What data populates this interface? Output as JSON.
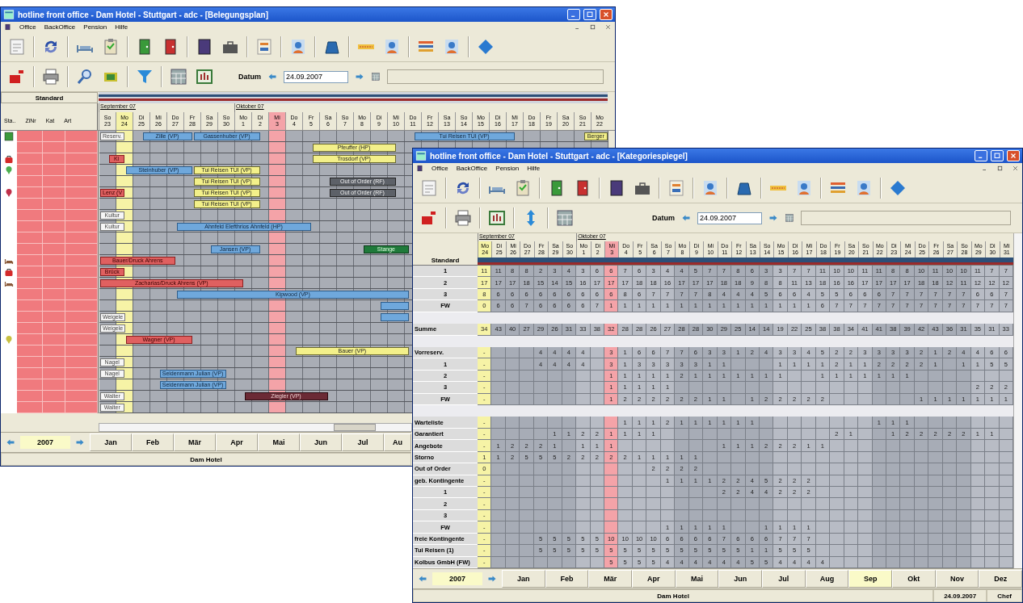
{
  "windows": [
    {
      "kind": "belegungsplan",
      "title": "hotline front office - Dam Hotel - Stuttgart - adc - [Belegungsplan]",
      "menu": [
        "Office",
        "BackOffice",
        "Pension",
        "Hilfe"
      ],
      "date_label": "Datum",
      "date": "24.09.2007",
      "view_button": "Standard",
      "columns": [
        "Sta..",
        "ZiNr",
        "Kat",
        "Art"
      ],
      "days": [
        {
          "dow": "So",
          "day": "23",
          "today": false,
          "holiday": false,
          "month": "September 07"
        },
        {
          "dow": "Mo",
          "day": "24",
          "today": true,
          "holiday": false
        },
        {
          "dow": "Di",
          "day": "25",
          "today": false,
          "holiday": false
        },
        {
          "dow": "Mi",
          "day": "26",
          "today": false,
          "holiday": false
        },
        {
          "dow": "Do",
          "day": "27",
          "today": false,
          "holiday": false
        },
        {
          "dow": "Fr",
          "day": "28",
          "today": false,
          "holiday": false
        },
        {
          "dow": "Sa",
          "day": "29",
          "today": false,
          "holiday": false
        },
        {
          "dow": "So",
          "day": "30",
          "today": false,
          "holiday": false
        },
        {
          "dow": "Mo",
          "day": "1",
          "today": false,
          "holiday": false,
          "month": "Oktober 07"
        },
        {
          "dow": "Di",
          "day": "2",
          "today": false,
          "holiday": false
        },
        {
          "dow": "Mi",
          "day": "3",
          "today": false,
          "holiday": true
        },
        {
          "dow": "Do",
          "day": "4",
          "today": false,
          "holiday": false
        },
        {
          "dow": "Fr",
          "day": "5",
          "today": false,
          "holiday": false
        },
        {
          "dow": "Sa",
          "day": "6",
          "today": false,
          "holiday": false
        },
        {
          "dow": "So",
          "day": "7",
          "today": false,
          "holiday": false
        },
        {
          "dow": "Mo",
          "day": "8",
          "today": false,
          "holiday": false
        },
        {
          "dow": "Di",
          "day": "9",
          "today": false,
          "holiday": false
        },
        {
          "dow": "Mi",
          "day": "10",
          "today": false,
          "holiday": false
        },
        {
          "dow": "Do",
          "day": "11",
          "today": false,
          "holiday": false
        },
        {
          "dow": "Fr",
          "day": "12",
          "today": false,
          "holiday": false
        },
        {
          "dow": "Sa",
          "day": "13",
          "today": false,
          "holiday": false
        },
        {
          "dow": "So",
          "day": "14",
          "today": false,
          "holiday": false
        },
        {
          "dow": "Mo",
          "day": "15",
          "today": false,
          "holiday": false
        },
        {
          "dow": "Di",
          "day": "16",
          "today": false,
          "holiday": false
        },
        {
          "dow": "Mi",
          "day": "17",
          "today": false,
          "holiday": false
        },
        {
          "dow": "Do",
          "day": "18",
          "today": false,
          "holiday": false
        },
        {
          "dow": "Fr",
          "day": "19",
          "today": false,
          "holiday": false
        },
        {
          "dow": "Sa",
          "day": "20",
          "today": false,
          "holiday": false
        },
        {
          "dow": "So",
          "day": "21",
          "today": false,
          "holiday": false
        },
        {
          "dow": "Mo",
          "day": "22",
          "today": false,
          "holiday": false
        }
      ],
      "rooms": [
        {
          "marker": {
            "kind": "square",
            "color": "#3c9a3c"
          },
          "bookings": [
            {
              "label": "Reserv.",
              "kind": "white"
            },
            {
              "label": "Zille (VP)",
              "kind": "blue"
            },
            {
              "label": "Gassenhuber (VP)",
              "kind": "blue"
            },
            {
              "label": "Tui Reisen TUI (VP)",
              "kind": "blue"
            },
            {
              "label": "Berger",
              "kind": "yellow"
            }
          ]
        },
        {
          "bookings": [
            {
              "label": "Pfeuffer (HP)",
              "kind": "yellow"
            }
          ]
        },
        {
          "marker": {
            "kind": "bag",
            "color": "#d42a2a"
          },
          "bookings": [
            {
              "label": "Ki",
              "kind": "red"
            },
            {
              "label": "Trosdorf (VP)",
              "kind": "yellow"
            }
          ]
        },
        {
          "marker": {
            "kind": "pin",
            "color": "#4caf50"
          },
          "bookings": [
            {
              "label": "Steinhuber (VP)",
              "kind": "blue"
            },
            {
              "label": "Tui Reisen TUI (VP)",
              "kind": "yellow"
            }
          ]
        },
        {
          "bookings": [
            {
              "label": "Tui Reisen TUI (VP)",
              "kind": "yellow"
            },
            {
              "label": "Out of Order (RF)",
              "kind": "gray"
            }
          ]
        },
        {
          "marker": {
            "kind": "pin",
            "color": "#c0304a"
          },
          "bookings": [
            {
              "label": "Lenz (V",
              "kind": "red"
            },
            {
              "label": "Tui Reisen TUI (VP)",
              "kind": "yellow"
            },
            {
              "label": "Out of Order (RF)",
              "kind": "gray"
            }
          ]
        },
        {
          "bookings": [
            {
              "label": "Tui Reisen TUI (VP)",
              "kind": "yellow"
            }
          ]
        },
        {
          "bookings": [
            {
              "label": "Kultur",
              "kind": "white"
            }
          ]
        },
        {
          "bookings": [
            {
              "label": "Kultur",
              "kind": "white"
            },
            {
              "label": "Ahnfeld Elefthrios Ahnfeld (HP)",
              "kind": "blue"
            }
          ]
        },
        {
          "selected": false
        },
        {
          "bookings": [
            {
              "label": "Jansen (VP)",
              "kind": "blue"
            },
            {
              "label": "Stange",
              "kind": "green"
            }
          ]
        },
        {
          "marker": {
            "kind": "bed",
            "color": "#8a5a3a"
          },
          "bookings": [
            {
              "label": "Bauer/Druck Ahrens",
              "kind": "red"
            }
          ]
        },
        {
          "marker": {
            "kind": "bag",
            "color": "#d42a2a"
          },
          "bookings": [
            {
              "label": "Brück",
              "kind": "red"
            }
          ]
        },
        {
          "marker": {
            "kind": "bed",
            "color": "#8a5a3a"
          },
          "bookings": [
            {
              "label": "Zacharias/Druck Ahrens (VP)",
              "kind": "red"
            }
          ]
        },
        {
          "bookings": [
            {
              "label": "Kipwood (VP)",
              "kind": "blue"
            }
          ]
        },
        {
          "bookings": [
            {
              "kind": "blue"
            }
          ]
        },
        {
          "bookings": [
            {
              "label": "Weigele",
              "kind": "white"
            },
            {
              "kind": "blue"
            }
          ]
        },
        {
          "bookings": [
            {
              "label": "Weigele",
              "kind": "white"
            }
          ]
        },
        {
          "marker": {
            "kind": "pin",
            "color": "#c8c040"
          },
          "bookings": [
            {
              "label": "Wagner (VP)",
              "kind": "red"
            }
          ]
        },
        {
          "bookings": [
            {
              "label": "Bauer (VP)",
              "kind": "yellow"
            }
          ]
        },
        {
          "bookings": [
            {
              "label": "Nagel",
              "kind": "white"
            }
          ]
        },
        {
          "bookings": [
            {
              "label": "Nagel",
              "kind": "white"
            },
            {
              "label": "Seidenmann Julian (VP)",
              "kind": "blue"
            }
          ]
        },
        {
          "bookings": [
            {
              "label": "Seidenmann Julian (VP)",
              "kind": "blue"
            }
          ]
        },
        {
          "bookings": [
            {
              "label": "Walter",
              "kind": "white"
            },
            {
              "label": "Ziegler (VP)",
              "kind": "maroon"
            }
          ]
        },
        {
          "bookings": [
            {
              "label": "Walter",
              "kind": "white"
            }
          ]
        }
      ],
      "year": "2007",
      "month_tabs": [
        {
          "label": "Jan",
          "selected": false
        },
        {
          "label": "Feb",
          "selected": false
        },
        {
          "label": "Mär",
          "selected": false
        },
        {
          "label": "Apr",
          "selected": false
        },
        {
          "label": "Mai",
          "selected": false
        },
        {
          "label": "Jun",
          "selected": false
        },
        {
          "label": "Jul",
          "selected": false
        },
        {
          "label": "Au",
          "selected": false
        }
      ],
      "status": [
        "Dam Hotel"
      ]
    },
    {
      "kind": "kategoriespiegel",
      "title": "hotline front office - Dam Hotel - Stuttgart - adc - [Kategoriespiegel]",
      "menu": [
        "Office",
        "BackOffice",
        "Pension",
        "Hilfe"
      ],
      "date_label": "Datum",
      "date": "24.09.2007",
      "view_button": "Standard",
      "days": [
        {
          "dow": "Mo",
          "day": "24",
          "today": true,
          "holiday": false,
          "month": "September 07"
        },
        {
          "dow": "Di",
          "day": "25",
          "today": false,
          "holiday": false
        },
        {
          "dow": "Mi",
          "day": "26",
          "today": false,
          "holiday": false
        },
        {
          "dow": "Do",
          "day": "27",
          "today": false,
          "holiday": false
        },
        {
          "dow": "Fr",
          "day": "28",
          "today": false,
          "holiday": false
        },
        {
          "dow": "Sa",
          "day": "29",
          "today": false,
          "holiday": false
        },
        {
          "dow": "So",
          "day": "30",
          "today": false,
          "holiday": false
        },
        {
          "dow": "Mo",
          "day": "1",
          "today": false,
          "holiday": false,
          "month": "Oktober 07"
        },
        {
          "dow": "Di",
          "day": "2",
          "today": false,
          "holiday": false
        },
        {
          "dow": "Mi",
          "day": "3",
          "today": false,
          "holiday": true
        },
        {
          "dow": "Do",
          "day": "4",
          "today": false,
          "holiday": false
        },
        {
          "dow": "Fr",
          "day": "5",
          "today": false,
          "holiday": false
        },
        {
          "dow": "Sa",
          "day": "6",
          "today": false,
          "holiday": false
        },
        {
          "dow": "So",
          "day": "7",
          "today": false,
          "holiday": false
        },
        {
          "dow": "Mo",
          "day": "8",
          "today": false,
          "holiday": false
        },
        {
          "dow": "Di",
          "day": "9",
          "today": false,
          "holiday": false
        },
        {
          "dow": "Mi",
          "day": "10",
          "today": false,
          "holiday": false
        },
        {
          "dow": "Do",
          "day": "11",
          "today": false,
          "holiday": false
        },
        {
          "dow": "Fr",
          "day": "12",
          "today": false,
          "holiday": false
        },
        {
          "dow": "Sa",
          "day": "13",
          "today": false,
          "holiday": false
        },
        {
          "dow": "So",
          "day": "14",
          "today": false,
          "holiday": false
        },
        {
          "dow": "Mo",
          "day": "15",
          "today": false,
          "holiday": false
        },
        {
          "dow": "Di",
          "day": "16",
          "today": false,
          "holiday": false
        },
        {
          "dow": "Mi",
          "day": "17",
          "today": false,
          "holiday": false
        },
        {
          "dow": "Do",
          "day": "18",
          "today": false,
          "holiday": false
        },
        {
          "dow": "Fr",
          "day": "19",
          "today": false,
          "holiday": false
        },
        {
          "dow": "Sa",
          "day": "20",
          "today": false,
          "holiday": false
        },
        {
          "dow": "So",
          "day": "21",
          "today": false,
          "holiday": false
        },
        {
          "dow": "Mo",
          "day": "22",
          "today": false,
          "holiday": false
        },
        {
          "dow": "Di",
          "day": "23",
          "today": false,
          "holiday": false
        },
        {
          "dow": "Mi",
          "day": "24",
          "today": false,
          "holiday": false
        },
        {
          "dow": "Do",
          "day": "25",
          "today": false,
          "holiday": false
        },
        {
          "dow": "Fr",
          "day": "26",
          "today": false,
          "holiday": false
        },
        {
          "dow": "Sa",
          "day": "27",
          "today": false,
          "holiday": false
        },
        {
          "dow": "So",
          "day": "28",
          "today": false,
          "holiday": false
        },
        {
          "dow": "Mo",
          "day": "29",
          "today": false,
          "holiday": false
        },
        {
          "dow": "Di",
          "day": "30",
          "today": false,
          "holiday": false
        },
        {
          "dow": "Mi",
          "day": "31",
          "today": false,
          "holiday": false
        }
      ],
      "rows": [
        {
          "kind": "sub",
          "label": "1",
          "cells": [
            "11",
            "11",
            "8",
            "8",
            "2",
            "3",
            "4",
            "3",
            "6",
            "6",
            "7",
            "6",
            "3",
            "4",
            "4",
            "5",
            "7",
            "7",
            "8",
            "6",
            "3",
            "3",
            "7",
            "7",
            "11",
            "10",
            "10",
            "11",
            "11",
            "8",
            "8",
            "10",
            "11",
            "10",
            "10",
            "11",
            "7",
            "7"
          ]
        },
        {
          "kind": "sub",
          "label": "2",
          "cells": [
            "17",
            "17",
            "17",
            "18",
            "15",
            "14",
            "15",
            "16",
            "17",
            "17",
            "17",
            "18",
            "18",
            "16",
            "17",
            "17",
            "17",
            "18",
            "18",
            "9",
            "8",
            "8",
            "11",
            "13",
            "18",
            "16",
            "16",
            "17",
            "17",
            "17",
            "17",
            "18",
            "18",
            "12",
            "11",
            "12",
            "12",
            "12"
          ]
        },
        {
          "kind": "sub",
          "label": "3",
          "cells": [
            "8",
            "6",
            "6",
            "6",
            "6",
            "6",
            "6",
            "6",
            "6",
            "6",
            "8",
            "6",
            "7",
            "7",
            "7",
            "7",
            "8",
            "4",
            "4",
            "4",
            "5",
            "6",
            "6",
            "4",
            "5",
            "5",
            "6",
            "6",
            "6",
            "7",
            "7",
            "7",
            "7",
            "7",
            "7",
            "6",
            "6",
            "7"
          ]
        },
        {
          "kind": "sub",
          "label": "FW",
          "cells": [
            "0",
            "6",
            "6",
            "7",
            "6",
            "6",
            "6",
            "6",
            "7",
            "1",
            "1",
            "1",
            "1",
            "1",
            "1",
            "1",
            "1",
            "1",
            "1",
            "1",
            "1",
            "1",
            "1",
            "1",
            "6",
            "7",
            "7",
            "7",
            "7",
            "7",
            "7",
            "7",
            "7",
            "7",
            "7",
            "7",
            "7",
            "7"
          ]
        },
        {
          "kind": "spacer"
        },
        {
          "kind": "group",
          "label": "Summe",
          "cells": [
            "34",
            "43",
            "40",
            "27",
            "29",
            "26",
            "31",
            "33",
            "38",
            "32",
            "28",
            "28",
            "26",
            "27",
            "28",
            "28",
            "30",
            "29",
            "25",
            "14",
            "14",
            "19",
            "22",
            "25",
            "38",
            "38",
            "34",
            "41",
            "41",
            "38",
            "39",
            "42",
            "43",
            "36",
            "31",
            "35",
            "31",
            "33"
          ]
        },
        {
          "kind": "spacer"
        },
        {
          "kind": "group",
          "label": "Vorreserv.",
          "cells": [
            "-",
            null,
            null,
            null,
            "4",
            "4",
            "4",
            "4",
            null,
            "3",
            "1",
            "6",
            "6",
            "7",
            "7",
            "6",
            "3",
            "3",
            "1",
            "2",
            "4",
            "3",
            "3",
            "4",
            "5",
            "2",
            "2",
            "3",
            "3",
            "3",
            "3",
            "2",
            "1",
            "2",
            "4",
            "4",
            "6",
            "6"
          ]
        },
        {
          "kind": "sub",
          "label": "1",
          "cells": [
            "-",
            null,
            null,
            null,
            "4",
            "4",
            "4",
            "4",
            null,
            "3",
            "1",
            "3",
            "3",
            "3",
            "3",
            "3",
            "1",
            "1",
            null,
            null,
            null,
            "1",
            "1",
            "1",
            "1",
            "2",
            "1",
            "1",
            "2",
            "2",
            "2",
            "2",
            "1",
            null,
            "1",
            "1",
            "5",
            "5"
          ]
        },
        {
          "kind": "sub",
          "label": "2",
          "cells": [
            "-",
            null,
            null,
            null,
            null,
            null,
            null,
            null,
            null,
            "1",
            "1",
            "1",
            "1",
            "1",
            "2",
            "1",
            "1",
            "1",
            "1",
            "1",
            "1",
            "1",
            null,
            null,
            "1",
            "1",
            "1",
            "1",
            "1",
            "1",
            "1",
            null,
            null,
            null,
            null,
            null,
            null,
            null
          ]
        },
        {
          "kind": "sub",
          "label": "3",
          "cells": [
            "-",
            null,
            null,
            null,
            null,
            null,
            null,
            null,
            null,
            "1",
            "1",
            "1",
            "1",
            "1",
            null,
            null,
            null,
            null,
            null,
            null,
            null,
            null,
            null,
            null,
            null,
            null,
            null,
            null,
            null,
            null,
            null,
            null,
            null,
            null,
            null,
            "2",
            "2",
            "2"
          ]
        },
        {
          "kind": "sub",
          "label": "FW",
          "cells": [
            "-",
            null,
            null,
            null,
            null,
            null,
            null,
            null,
            null,
            "1",
            "2",
            "2",
            "2",
            "2",
            "2",
            "2",
            "1",
            "1",
            null,
            "1",
            "2",
            "2",
            "2",
            "2",
            "2",
            null,
            null,
            null,
            null,
            null,
            null,
            "1",
            "1",
            "1",
            "1",
            "1",
            "1",
            "1"
          ]
        },
        {
          "kind": "spacer"
        },
        {
          "kind": "group",
          "label": "Warteliste",
          "cells": [
            "-",
            null,
            null,
            null,
            null,
            null,
            null,
            null,
            null,
            null,
            "1",
            "1",
            "1",
            "2",
            "1",
            "1",
            "1",
            "1",
            "1",
            "1",
            null,
            null,
            null,
            null,
            null,
            null,
            null,
            null,
            "1",
            "1",
            "1",
            null,
            null,
            null,
            null,
            null,
            null,
            null
          ]
        },
        {
          "kind": "group",
          "label": "Garantiert",
          "cells": [
            "-",
            null,
            null,
            null,
            null,
            "1",
            "1",
            "2",
            "2",
            "1",
            "1",
            "1",
            "1",
            null,
            null,
            null,
            null,
            null,
            null,
            null,
            null,
            null,
            null,
            null,
            null,
            "2",
            "1",
            null,
            null,
            "1",
            "2",
            "2",
            "2",
            "2",
            "2",
            "1",
            "1",
            null
          ]
        },
        {
          "kind": "group",
          "label": "Angebote",
          "cells": [
            "-",
            "1",
            "2",
            "2",
            "2",
            "1",
            null,
            "1",
            "1",
            "1",
            null,
            null,
            null,
            null,
            null,
            null,
            null,
            "1",
            "1",
            "1",
            "2",
            "2",
            "2",
            "1",
            "1",
            null,
            null,
            null,
            null,
            null,
            null,
            null,
            null,
            null,
            null,
            null,
            null,
            null
          ]
        },
        {
          "kind": "group",
          "label": "Storno",
          "cells": [
            "1",
            "1",
            "2",
            "5",
            "5",
            "5",
            "2",
            "2",
            "2",
            "2",
            "2",
            "1",
            "1",
            "1",
            "1",
            "1",
            null,
            null,
            null,
            null,
            null,
            null,
            null,
            null,
            null,
            null,
            null,
            null,
            null,
            null,
            null,
            null,
            null,
            null,
            null,
            null,
            null,
            null
          ]
        },
        {
          "kind": "group",
          "label": "Out of Order",
          "cells": [
            "0",
            null,
            null,
            null,
            null,
            null,
            null,
            null,
            null,
            null,
            null,
            null,
            "2",
            "2",
            "2",
            "2",
            null,
            null,
            null,
            null,
            null,
            null,
            null,
            null,
            null,
            null,
            null,
            null,
            null,
            null,
            null,
            null,
            null,
            null,
            null,
            null,
            null,
            null
          ]
        },
        {
          "kind": "group",
          "label": "geb. Kontingente",
          "cells": [
            "-",
            null,
            null,
            null,
            null,
            null,
            null,
            null,
            null,
            null,
            null,
            null,
            null,
            "1",
            "1",
            "1",
            "1",
            "2",
            "2",
            "4",
            "5",
            "2",
            "2",
            "2",
            null,
            null,
            null,
            null,
            null,
            null,
            null,
            null,
            null,
            null,
            null,
            null,
            null,
            null
          ]
        },
        {
          "kind": "sub",
          "label": "1",
          "cells": [
            "-",
            null,
            null,
            null,
            null,
            null,
            null,
            null,
            null,
            null,
            null,
            null,
            null,
            null,
            null,
            null,
            null,
            "2",
            "2",
            "4",
            "4",
            "2",
            "2",
            "2",
            null,
            null,
            null,
            null,
            null,
            null,
            null,
            null,
            null,
            null,
            null,
            null,
            null,
            null
          ]
        },
        {
          "kind": "sub",
          "label": "2",
          "cells": [
            "-",
            null,
            null,
            null,
            null,
            null,
            null,
            null,
            null,
            null,
            null,
            null,
            null,
            null,
            null,
            null,
            null,
            null,
            null,
            null,
            null,
            null,
            null,
            null,
            null,
            null,
            null,
            null,
            null,
            null,
            null,
            null,
            null,
            null,
            null,
            null,
            null,
            null
          ]
        },
        {
          "kind": "sub",
          "label": "3",
          "cells": [
            "-",
            null,
            null,
            null,
            null,
            null,
            null,
            null,
            null,
            null,
            null,
            null,
            null,
            null,
            null,
            null,
            null,
            null,
            null,
            null,
            null,
            null,
            null,
            null,
            null,
            null,
            null,
            null,
            null,
            null,
            null,
            null,
            null,
            null,
            null,
            null,
            null,
            null
          ]
        },
        {
          "kind": "sub",
          "label": "FW",
          "cells": [
            "-",
            null,
            null,
            null,
            null,
            null,
            null,
            null,
            null,
            null,
            null,
            null,
            null,
            "1",
            "1",
            "1",
            "1",
            "1",
            null,
            null,
            "1",
            "1",
            "1",
            "1",
            null,
            null,
            null,
            null,
            null,
            null,
            null,
            null,
            null,
            null,
            null,
            null,
            null,
            null
          ]
        },
        {
          "kind": "group",
          "label": "freie Kontingente",
          "cells": [
            "-",
            null,
            null,
            null,
            "5",
            "5",
            "5",
            "5",
            "5",
            "10",
            "10",
            "10",
            "10",
            "6",
            "6",
            "6",
            "6",
            "7",
            "6",
            "6",
            "6",
            "7",
            "7",
            "7",
            null,
            null,
            null,
            null,
            null,
            null,
            null,
            null,
            null,
            null,
            null,
            null,
            null,
            null
          ]
        },
        {
          "kind": "group",
          "label": "Tui Reisen (1)",
          "cells": [
            "-",
            null,
            null,
            null,
            "5",
            "5",
            "5",
            "5",
            "5",
            "5",
            "5",
            "5",
            "5",
            "5",
            "5",
            "5",
            "5",
            "5",
            "5",
            "1",
            "1",
            "5",
            "5",
            "5",
            null,
            null,
            null,
            null,
            null,
            null,
            null,
            null,
            null,
            null,
            null,
            null,
            null,
            null
          ]
        },
        {
          "kind": "group",
          "label": "Kolbus GmbH (FW)",
          "cells": [
            "-",
            null,
            null,
            null,
            null,
            null,
            null,
            null,
            null,
            "5",
            "5",
            "5",
            "5",
            "4",
            "4",
            "4",
            "4",
            "4",
            "4",
            "5",
            "5",
            "4",
            "4",
            "4",
            "4",
            null,
            null,
            null,
            null,
            null,
            null,
            null,
            null,
            null,
            null,
            null,
            null,
            null
          ]
        }
      ],
      "year": "2007",
      "month_tabs": [
        {
          "label": "Jan",
          "selected": false
        },
        {
          "label": "Feb",
          "selected": false
        },
        {
          "label": "Mär",
          "selected": false
        },
        {
          "label": "Apr",
          "selected": false
        },
        {
          "label": "Mai",
          "selected": false
        },
        {
          "label": "Jun",
          "selected": false
        },
        {
          "label": "Jul",
          "selected": false
        },
        {
          "label": "Aug",
          "selected": false
        },
        {
          "label": "Sep",
          "selected": true
        },
        {
          "label": "Okt",
          "selected": false
        },
        {
          "label": "Nov",
          "selected": false
        },
        {
          "label": "Dez",
          "selected": false
        }
      ],
      "status": [
        "Dam Hotel",
        "24.09.2007",
        "Chef"
      ]
    }
  ]
}
